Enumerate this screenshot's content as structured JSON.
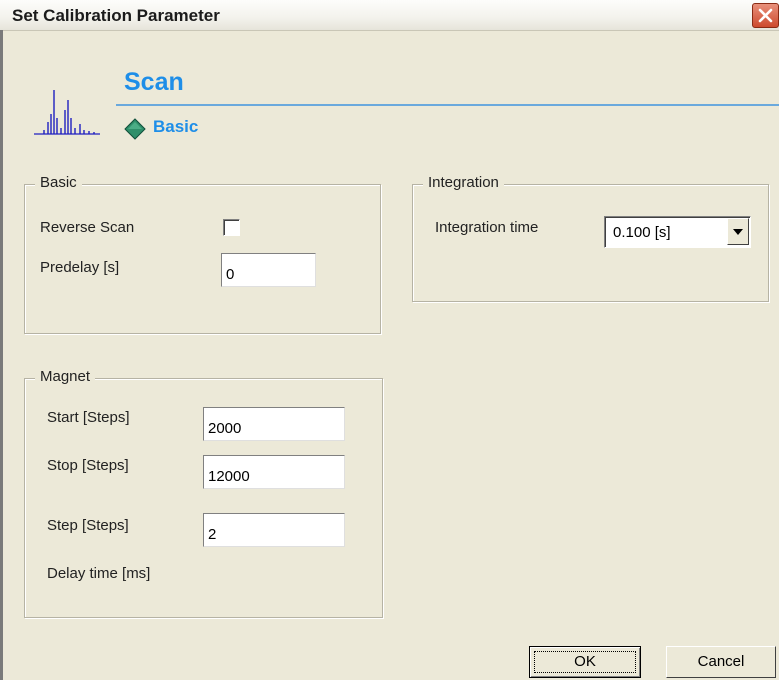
{
  "window": {
    "title": "Set Calibration Parameter"
  },
  "header": {
    "title": "Scan",
    "subtitle": "Basic",
    "icon": "spectrum-icon",
    "subtitle_icon": "diamond-icon"
  },
  "basic_group": {
    "title": "Basic",
    "reverse_scan_label": "Reverse Scan",
    "reverse_scan_checked": false,
    "predelay_label": "Predelay [s]",
    "predelay_value": "0"
  },
  "integration_group": {
    "title": "Integration",
    "integration_time_label": "Integration time",
    "integration_time_value": "0.100 [s]"
  },
  "magnet_group": {
    "title": "Magnet",
    "start_label": "Start [Steps]",
    "start_value": "2000",
    "stop_label": "Stop [Steps]",
    "stop_value": "12000",
    "step_label": "Step [Steps]",
    "step_value": "2",
    "delay_label": "Delay time [ms]"
  },
  "buttons": {
    "ok": "OK",
    "cancel": "Cancel"
  },
  "colors": {
    "accent": "#1e8ee8",
    "dialog_bg": "#ece9d8",
    "close_button": "#d9583a"
  }
}
